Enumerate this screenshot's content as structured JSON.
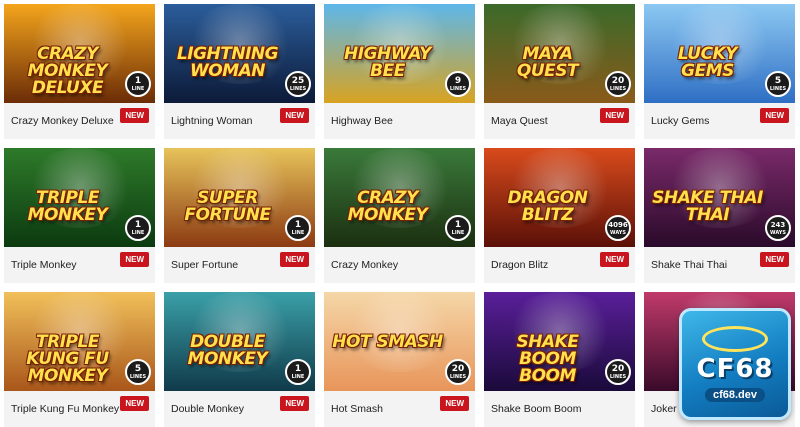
{
  "games": [
    {
      "name": "Crazy Monkey Deluxe",
      "logo": "CRAZY MONKEY Deluxe",
      "count": "1",
      "unit": "LINE",
      "badge": "NEW",
      "bg_top": "#f4a51c",
      "bg_bottom": "#6b2c07"
    },
    {
      "name": "Lightning Woman",
      "logo": "LIGHTNING WOMAN",
      "count": "25",
      "unit": "LINES",
      "badge": "NEW",
      "bg_top": "#2b5d9b",
      "bg_bottom": "#0c1a38"
    },
    {
      "name": "Highway Bee",
      "logo": "HIGHWAY BEE",
      "count": "9",
      "unit": "LINES",
      "badge": "",
      "bg_top": "#5db7ea",
      "bg_bottom": "#d8a321"
    },
    {
      "name": "Maya Quest",
      "logo": "MAYA QUEST",
      "count": "20",
      "unit": "LINES",
      "badge": "NEW",
      "bg_top": "#3b6a2a",
      "bg_bottom": "#8a5a1a"
    },
    {
      "name": "Lucky Gems",
      "logo": "LUCKY GEMS",
      "count": "5",
      "unit": "LINES",
      "badge": "NEW",
      "bg_top": "#8cc8f2",
      "bg_bottom": "#2f6fc4"
    },
    {
      "name": "Triple Monkey",
      "logo": "Triple monkey",
      "count": "1",
      "unit": "LINE",
      "badge": "NEW",
      "bg_top": "#2e7a2a",
      "bg_bottom": "#0c3a10"
    },
    {
      "name": "Super Fortune",
      "logo": "SUPER FORTUNE",
      "count": "1",
      "unit": "LINE",
      "badge": "NEW",
      "bg_top": "#e7c35a",
      "bg_bottom": "#8c3a12"
    },
    {
      "name": "Crazy Monkey",
      "logo": "CRAZY MONKEY",
      "count": "1",
      "unit": "LINE",
      "badge": "",
      "bg_top": "#3a7a3a",
      "bg_bottom": "#1b2f10"
    },
    {
      "name": "Dragon Blitz",
      "logo": "DRAGON BLITZ",
      "count": "4096",
      "unit": "WAYS",
      "badge": "NEW",
      "bg_top": "#d94b1c",
      "bg_bottom": "#5a1008"
    },
    {
      "name": "Shake Thai Thai",
      "logo": "shake thai thai",
      "count": "243",
      "unit": "WAYS",
      "badge": "NEW",
      "bg_top": "#7a2a6a",
      "bg_bottom": "#2a0a2a"
    },
    {
      "name": "Triple Kung Fu Monkey",
      "logo": "TRIPLE KUNG FU MONKEY",
      "count": "5",
      "unit": "LINES",
      "badge": "NEW",
      "bg_top": "#f1c05a",
      "bg_bottom": "#a9561a"
    },
    {
      "name": "Double Monkey",
      "logo": "DOUBLE MONKEY",
      "count": "1",
      "unit": "LINE",
      "badge": "NEW",
      "bg_top": "#3aa0a8",
      "bg_bottom": "#103a4a"
    },
    {
      "name": "Hot Smash",
      "logo": "Hot Smash",
      "count": "20",
      "unit": "LINES",
      "badge": "NEW",
      "bg_top": "#f5d7a8",
      "bg_bottom": "#e8955a"
    },
    {
      "name": "Shake Boom Boom",
      "logo": "SHAKE Boom Boom",
      "count": "20",
      "unit": "LINES",
      "badge": "",
      "bg_top": "#5a1f9a",
      "bg_bottom": "#1a0a3a"
    },
    {
      "name": "Joker K",
      "logo": "",
      "count": "",
      "unit": "",
      "badge": "",
      "bg_top": "#c03a6a",
      "bg_bottom": "#3a0a2a"
    }
  ],
  "brand": {
    "word": "CF68",
    "domain": "cf68.dev"
  },
  "colors": {
    "new_badge": "#c9151d",
    "card_bg": "#f3f3f3",
    "brand_blue": "#137ec2"
  }
}
